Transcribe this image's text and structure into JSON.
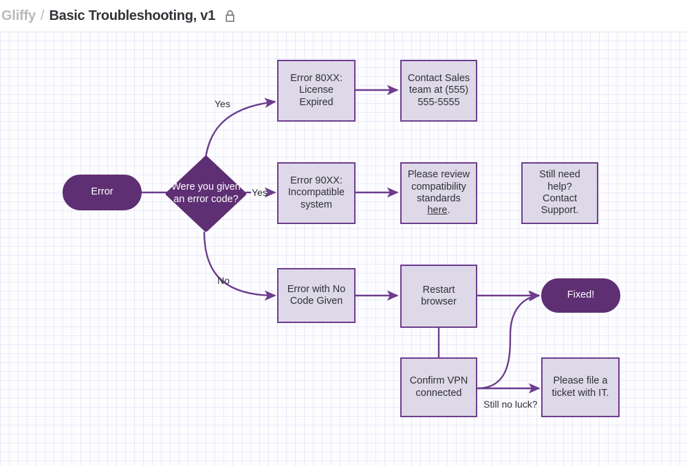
{
  "header": {
    "app_name": "Gliffy",
    "separator": "/",
    "document_title": "Basic Troubleshooting, v1",
    "lock_icon": "lock-closed-icon"
  },
  "colors": {
    "dark_purple": "#5e2f73",
    "border_purple": "#6d3c8e",
    "light_fill": "#ded9e8",
    "canvas_bg": "#fdfdff",
    "grid_minor": "#e9e9fb",
    "grid_major": "#dcdcf8",
    "text_dark": "#2f2f36",
    "crumb_muted": "#b9b9bd"
  },
  "diagram": {
    "nodes": [
      {
        "id": "error-start",
        "label": "Error",
        "shape": "terminator"
      },
      {
        "id": "decision-error-code",
        "label": "Were you given\nan error code?",
        "shape": "decision"
      },
      {
        "id": "error-80xx",
        "label": "Error 80XX:\nLicense Expired",
        "shape": "process"
      },
      {
        "id": "contact-sales",
        "label": "Contact Sales\nteam at (555)\n555-5555",
        "shape": "process"
      },
      {
        "id": "error-90xx",
        "label": "Error 90XX:\nIncompatible\nsystem",
        "shape": "process"
      },
      {
        "id": "review-compat",
        "label": "Please review\ncompatibility\nstandards here.",
        "shape": "process",
        "link_text": "here"
      },
      {
        "id": "still-need-help",
        "label": "Still need help?\nContact Support.",
        "shape": "process"
      },
      {
        "id": "error-no-code",
        "label": "Error with No\nCode Given",
        "shape": "process"
      },
      {
        "id": "restart-browser",
        "label": "Restart browser",
        "shape": "process"
      },
      {
        "id": "confirm-vpn",
        "label": "Confirm VPN\nconnected",
        "shape": "process"
      },
      {
        "id": "fixed",
        "label": "Fixed!",
        "shape": "terminator"
      },
      {
        "id": "file-ticket",
        "label": "Please file a\nticket with IT.",
        "shape": "process"
      }
    ],
    "edge_labels": {
      "yes_up": "Yes",
      "yes_mid": "Yes",
      "no_down": "No",
      "still_no_luck": "Still no luck?"
    }
  }
}
